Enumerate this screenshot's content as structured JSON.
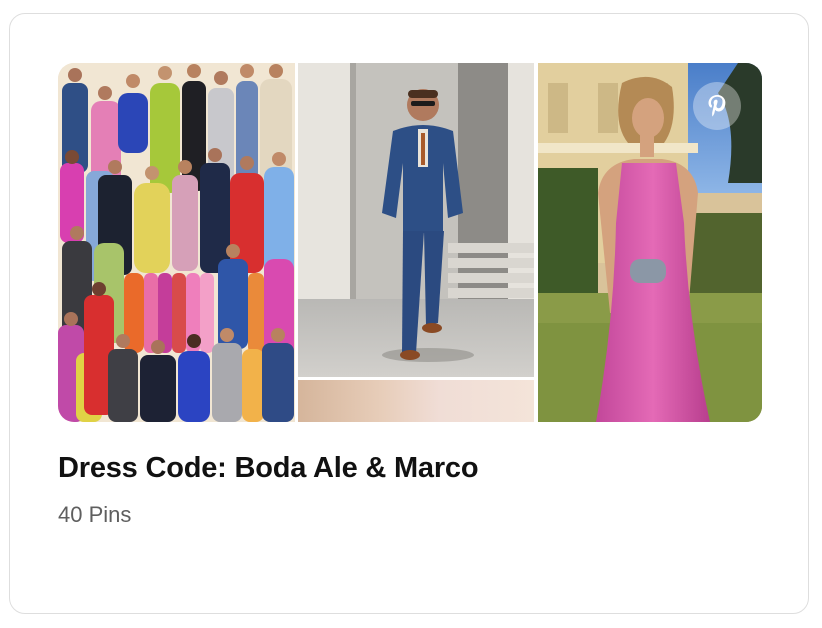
{
  "board": {
    "title": "Dress Code: Boda Ale & Marco",
    "pin_count": "40 Pins",
    "icon": "pinterest-logo-icon"
  },
  "colors": {
    "text_primary": "#111111",
    "text_secondary": "#5f5f5f",
    "card_border": "#dedede"
  }
}
